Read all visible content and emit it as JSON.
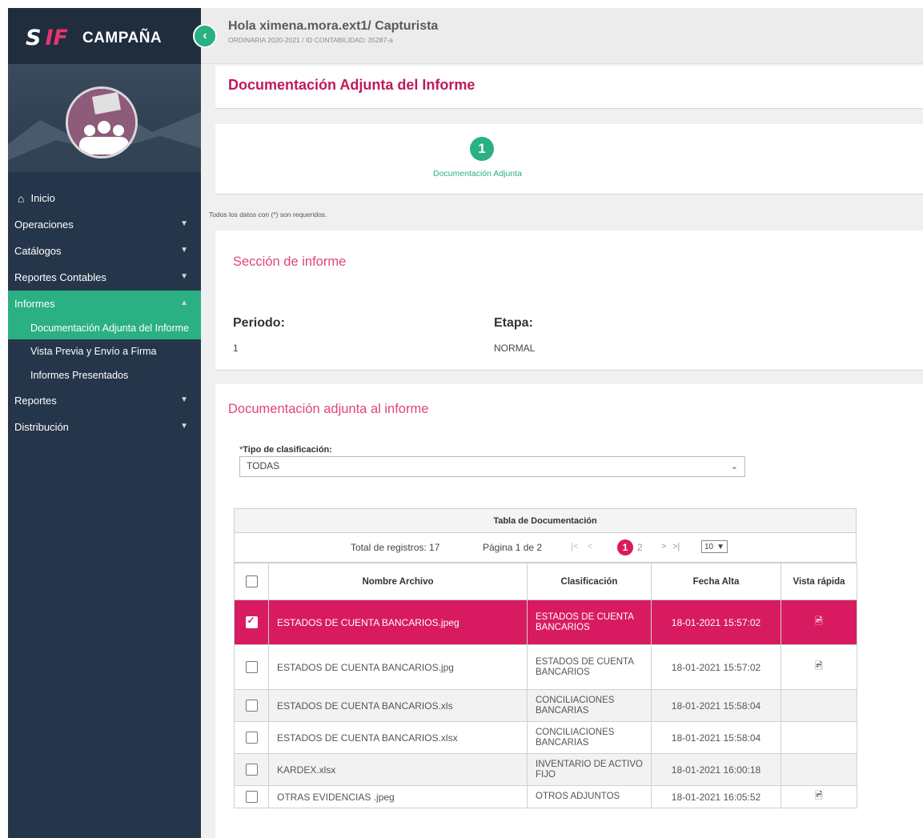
{
  "brand": {
    "logo_s": "S",
    "logo_if": "IF",
    "name": "CAMPAÑA"
  },
  "colors": {
    "sidebar": "#25364a",
    "accent_green": "#2ab083",
    "accent_pink": "#d81b60",
    "title_pink": "#c2185b"
  },
  "nav": {
    "inicio": "Inicio",
    "operaciones": "Operaciones",
    "catalogos": "Catálogos",
    "reportes_contables": "Reportes Contables",
    "informes": "Informes",
    "informes_sub": [
      "Documentación Adjunta del Informe",
      "Vista Previa y Envío a Firma",
      "Informes Presentados"
    ],
    "reportes": "Reportes",
    "distribucion": "Distribución"
  },
  "header": {
    "greeting": "Hola ximena.mora.ext1/ Capturista",
    "subtitle": "ORDINARIA 2020-2021 / ID CONTABILIDAD: 35287-a"
  },
  "page_title": "Documentación Adjunta del Informe",
  "stepper": {
    "number": "1",
    "label": "Documentación Adjunta"
  },
  "required_note": "Todos los datos con (*) son requeridos.",
  "section": {
    "title": "Sección de informe",
    "periodo_label": "Periodo:",
    "periodo_value": "1",
    "etapa_label": "Etapa:",
    "etapa_value": "NORMAL"
  },
  "documents": {
    "title": "Documentación adjunta al informe",
    "clasificacion_label": "Tipo de clasificación:",
    "clasificacion_required": "*",
    "clasificacion_value": "TODAS",
    "table_title": "Tabla de Documentación",
    "total": "Total de registros: 17",
    "page_info": "Página 1 de 2",
    "nav_first": "|<",
    "nav_prev": "<",
    "page_current": "1",
    "page_next_num": "2",
    "nav_next": ">",
    "nav_last": ">|",
    "page_size": "10",
    "columns": [
      "Nombre Archivo",
      "Clasificación",
      "Fecha Alta",
      "Vista rápida"
    ],
    "rows": [
      {
        "name": "ESTADOS DE CUENTA BANCARIOS.jpeg",
        "clas": "ESTADOS DE CUENTA BANCARIOS",
        "date": "18-01-2021 15:57:02",
        "preview": "image-file-icon",
        "selected": true
      },
      {
        "name": "ESTADOS DE CUENTA BANCARIOS.jpg",
        "clas": "ESTADOS DE CUENTA BANCARIOS",
        "date": "18-01-2021 15:57:02",
        "preview": "image-file-icon",
        "selected": false
      },
      {
        "name": "ESTADOS DE CUENTA BANCARIOS.xls",
        "clas": "CONCILIACIONES BANCARIAS",
        "date": "18-01-2021 15:58:04",
        "preview": "",
        "selected": false
      },
      {
        "name": "ESTADOS DE CUENTA BANCARIOS.xlsx",
        "clas": "CONCILIACIONES BANCARIAS",
        "date": "18-01-2021 15:58:04",
        "preview": "",
        "selected": false
      },
      {
        "name": "KARDEX.xlsx",
        "clas": "INVENTARIO DE ACTIVO FIJO",
        "date": "18-01-2021 16:00:18",
        "preview": "",
        "selected": false
      },
      {
        "name": "OTRAS EVIDENCIAS .jpeg",
        "clas": "OTROS ADJUNTOS",
        "date": "18-01-2021 16:05:52",
        "preview": "image-file-icon",
        "selected": false
      }
    ]
  }
}
